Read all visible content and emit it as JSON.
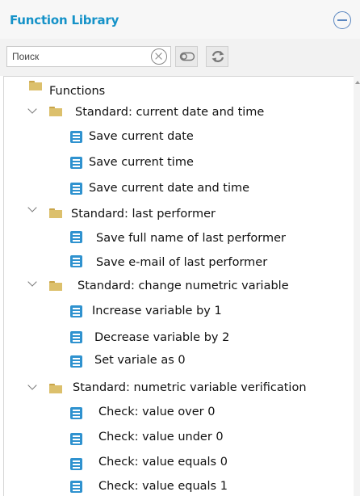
{
  "header": {
    "title": "Function Library"
  },
  "toolbar": {
    "search_placeholder": "Поиск"
  },
  "tree": {
    "root_label": "Functions",
    "groups": [
      {
        "label": "Standard: current date and time",
        "items": [
          "Save current date",
          "Save current time",
          "Save current date and time"
        ]
      },
      {
        "label": "Standard: last performer",
        "items": [
          "Save full name of last performer",
          "Save e-mail of last performer"
        ]
      },
      {
        "label": "Standard: change numetric variable",
        "items": [
          "Increase variable by 1",
          "Decrease variable by 2",
          "Set variale as 0"
        ]
      },
      {
        "label": "Standard: numetric variable verification",
        "items": [
          "Check: value over  0",
          "Check: value under  0",
          "Check: value equals 0",
          "Check: value equals 1"
        ]
      }
    ]
  },
  "colors": {
    "accent": "#1592c8",
    "func_icon": "#2f92cf",
    "folder": "#dcc06c",
    "collapse_icon": "#5a86c0"
  }
}
